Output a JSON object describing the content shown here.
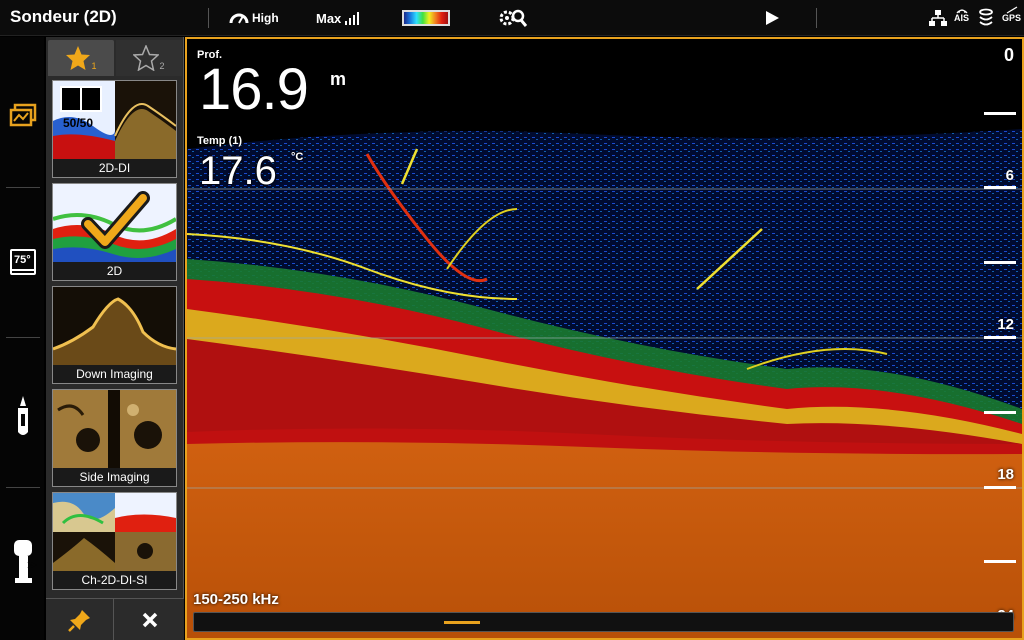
{
  "topbar": {
    "title": "Sondeur (2D)",
    "sensitivity_label": "High",
    "max_label": "Max",
    "status_icons": [
      "network-icon",
      "ais-icon",
      "sonar-stack-icon",
      "gps-icon"
    ],
    "ais_label": "AIS",
    "gps_label": "GPS"
  },
  "rail": {
    "items": [
      "views-icon",
      "water-temp-icon",
      "boat-icon",
      "motor-icon"
    ],
    "temp_badge": "75°"
  },
  "favorites": {
    "tab1_number": "1",
    "tab2_number": "2",
    "items": [
      {
        "label": "2D-DI",
        "badge": "50/50"
      },
      {
        "label": "2D"
      },
      {
        "label": "Down Imaging"
      },
      {
        "label": "Side Imaging"
      },
      {
        "label": "Ch-2D-DI-SI"
      }
    ]
  },
  "sonar": {
    "depth_label": "Prof.",
    "depth_value": "16.9",
    "depth_unit": "m",
    "temp_label": "Temp (1)",
    "temp_value": "17.6",
    "temp_unit": "°C",
    "scale": [
      "0",
      "6",
      "12",
      "18",
      "24"
    ],
    "frequency": "150-250 kHz"
  },
  "colors": {
    "accent": "#e8a21e",
    "bottom": "#c85a08",
    "bottom_edge": "#b01010"
  }
}
